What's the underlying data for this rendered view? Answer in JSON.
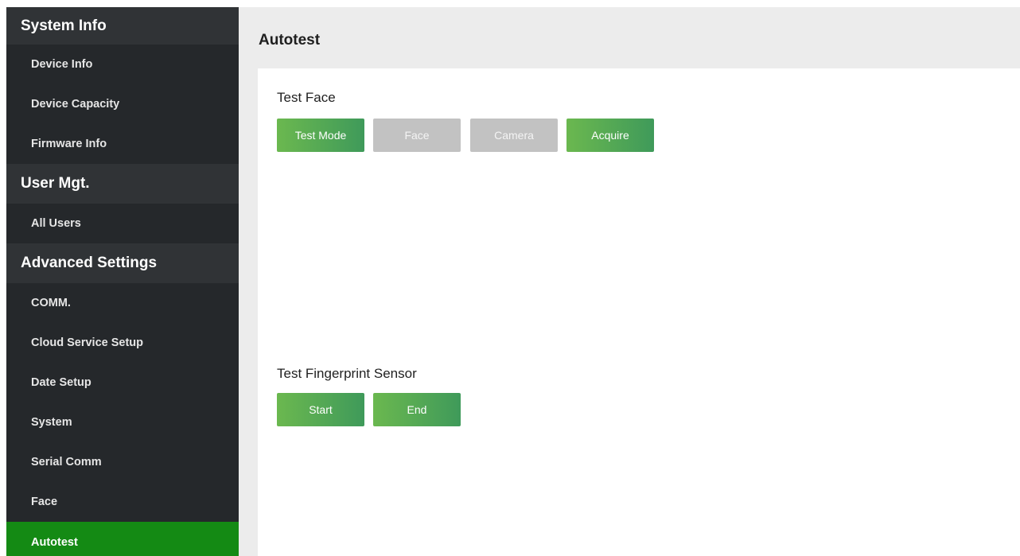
{
  "sidebar": {
    "groups": [
      {
        "title": "System Info",
        "items": [
          "Device Info",
          "Device Capacity",
          "Firmware Info"
        ]
      },
      {
        "title": "User Mgt.",
        "items": [
          "All Users"
        ]
      },
      {
        "title": "Advanced Settings",
        "items": [
          "COMM.",
          "Cloud Service Setup",
          "Date Setup",
          "System",
          "Serial Comm",
          "Face",
          "Autotest"
        ]
      }
    ],
    "active_item": "Autotest"
  },
  "page": {
    "title": "Autotest"
  },
  "face_test": {
    "label": "Test Face",
    "buttons": [
      {
        "label": "Test Mode",
        "state": "enabled"
      },
      {
        "label": "Face",
        "state": "disabled"
      },
      {
        "label": "Camera",
        "state": "disabled"
      },
      {
        "label": "Acquire",
        "state": "enabled"
      }
    ]
  },
  "fingerprint_test": {
    "label": "Test Fingerprint Sensor",
    "buttons": [
      {
        "label": "Start",
        "state": "enabled"
      },
      {
        "label": "End",
        "state": "enabled"
      }
    ]
  },
  "colors": {
    "sidebar_bg": "#25282b",
    "group_header_bg": "#303336",
    "active_item_bg": "#148a14",
    "button_green_start": "#6bb84f",
    "button_green_end": "#3f9a5a",
    "button_disabled": "#c2c2c2",
    "page_bg": "#ececec"
  }
}
